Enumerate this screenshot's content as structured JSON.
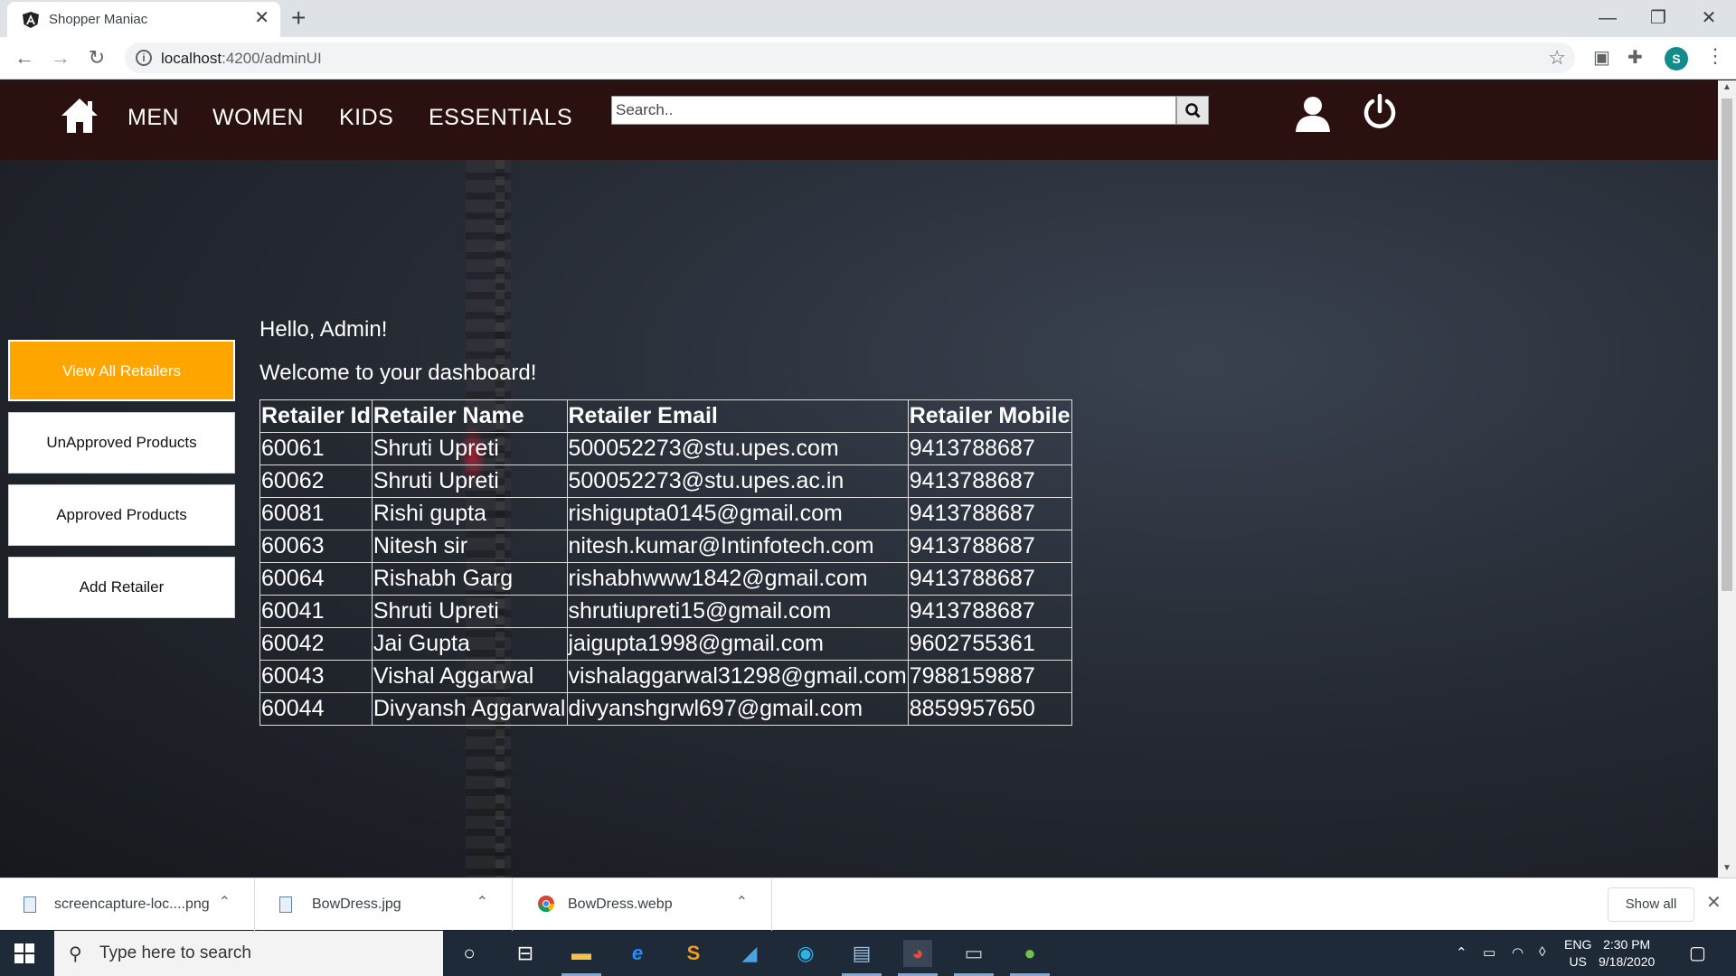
{
  "browser": {
    "tab_title": "Shopper Maniac",
    "url_host": "localhost",
    "url_path": ":4200/adminUI",
    "profile_initial": "S"
  },
  "nav": {
    "links": [
      "MEN",
      "WOMEN",
      "KIDS",
      "ESSENTIALS"
    ],
    "search_placeholder": "Search.."
  },
  "sidebar": {
    "items": [
      {
        "label": "View All Retailers",
        "active": true
      },
      {
        "label": "UnApproved Products",
        "active": false
      },
      {
        "label": "Approved Products",
        "active": false
      },
      {
        "label": "Add Retailer",
        "active": false
      }
    ]
  },
  "main": {
    "hello": "Hello, Admin!",
    "welcome": "Welcome to your dashboard!"
  },
  "table": {
    "headers": [
      "Retailer Id",
      "Retailer Name",
      "Retailer Email",
      "Retailer Mobile"
    ],
    "rows": [
      [
        "60061",
        "Shruti Upreti",
        "500052273@stu.upes.com",
        "9413788687"
      ],
      [
        "60062",
        "Shruti Upreti",
        "500052273@stu.upes.ac.in",
        "9413788687"
      ],
      [
        "60081",
        "Rishi gupta",
        "rishigupta0145@gmail.com",
        "9413788687"
      ],
      [
        "60063",
        "Nitesh sir",
        "nitesh.kumar@Intinfotech.com",
        "9413788687"
      ],
      [
        "60064",
        "Rishabh Garg",
        "rishabhwww1842@gmail.com",
        "9413788687"
      ],
      [
        "60041",
        "Shruti Upreti",
        "shrutiupreti15@gmail.com",
        "9413788687"
      ],
      [
        "60042",
        "Jai Gupta",
        "jaigupta1998@gmail.com",
        "9602755361"
      ],
      [
        "60043",
        "Vishal Aggarwal",
        "vishalaggarwal31298@gmail.com",
        "7988159887"
      ],
      [
        "60044",
        "Divyansh Aggarwal",
        "divyanshgrwl697@gmail.com",
        "8859957650"
      ]
    ]
  },
  "downloads": {
    "items": [
      "screencapture-loc....png",
      "BowDress.jpg",
      "BowDress.webp"
    ],
    "show_all": "Show all"
  },
  "taskbar": {
    "search_placeholder": "Type here to search",
    "lang_line1": "ENG",
    "lang_line2": "US",
    "time": "2:30 PM",
    "date": "9/18/2020"
  },
  "colors": {
    "navbar": "#2b1010",
    "active_button": "#ffa500"
  }
}
